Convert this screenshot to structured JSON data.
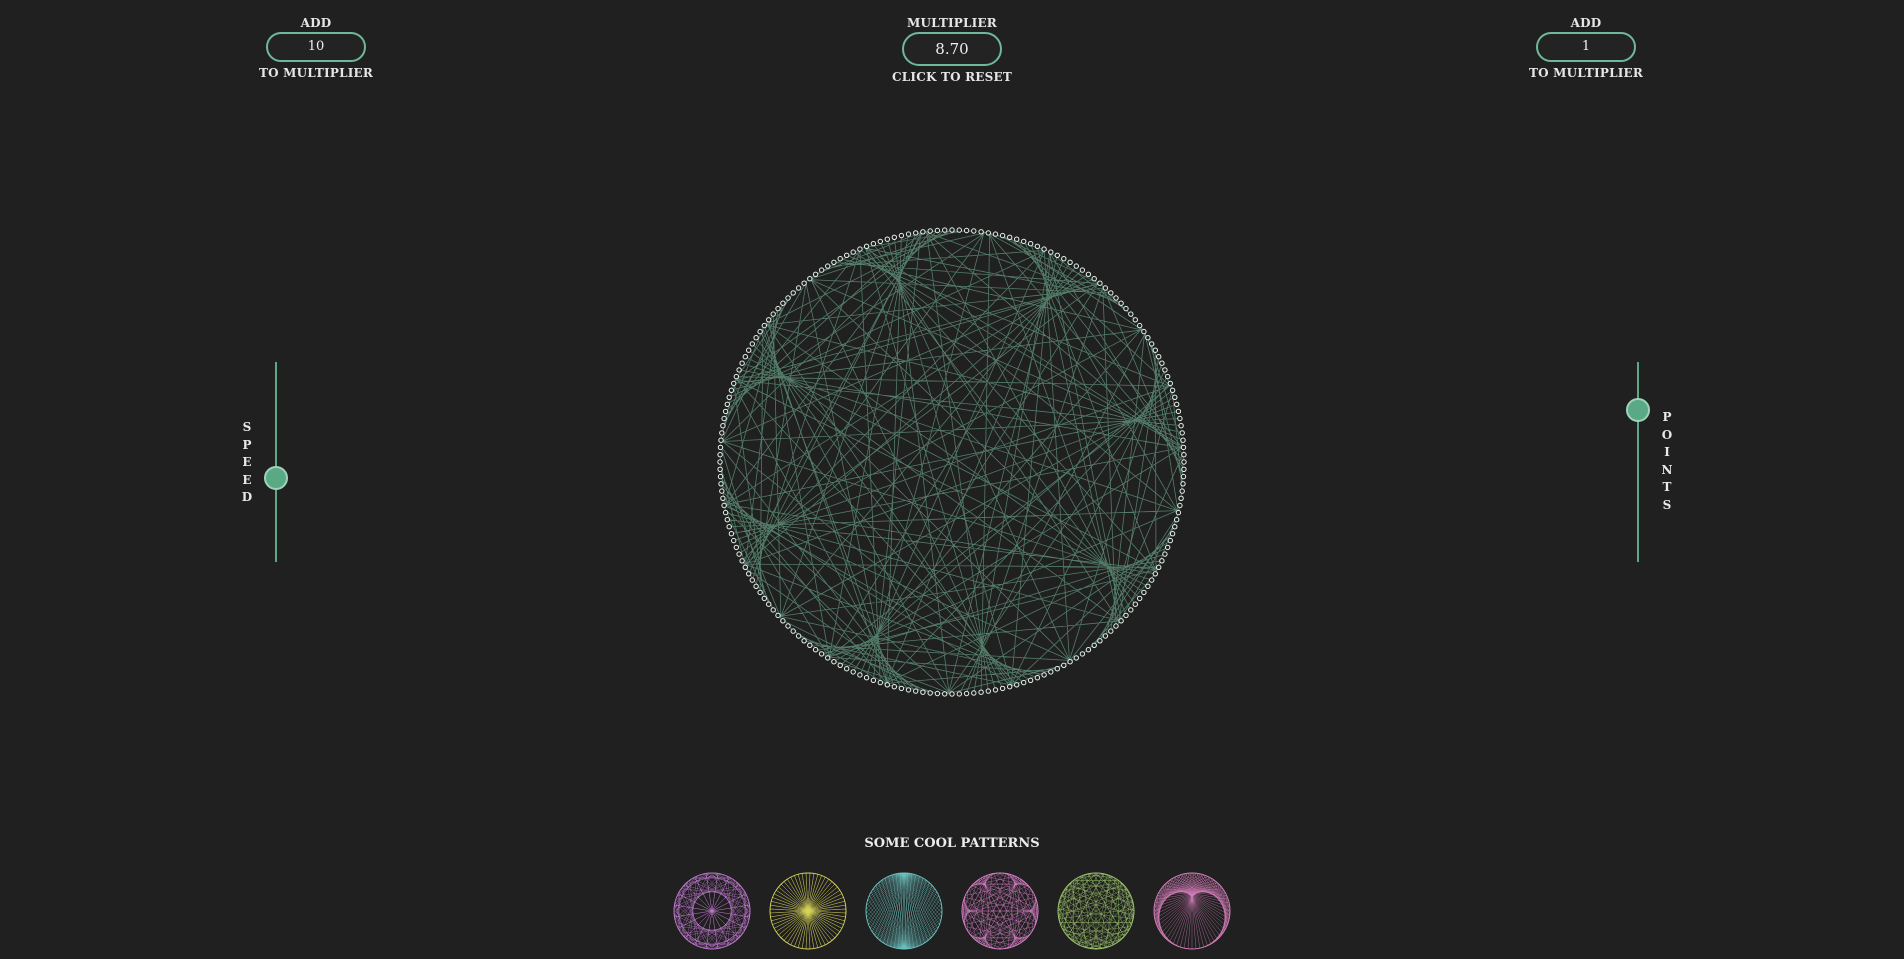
{
  "left_control": {
    "top_label": "ADD",
    "value": "10",
    "bottom_label": "TO MULTIPLIER"
  },
  "multiplier_control": {
    "top_label": "MULTIPLIER",
    "value": "8.70",
    "bottom_label": "CLICK TO RESET"
  },
  "right_control": {
    "top_label": "ADD",
    "value": "1",
    "bottom_label": "TO MULTIPLIER"
  },
  "speed_slider": {
    "label": "SPEED",
    "level": 0.58
  },
  "points_slider": {
    "label": "POINTS",
    "level": 0.24
  },
  "main_visual": {
    "points": 200,
    "multiplier": 8.7,
    "line_color": "#7ec9a6",
    "dot_color": "#e8f4ee"
  },
  "patterns": {
    "title": "SOME COOL PATTERNS",
    "items": [
      {
        "name": "pattern-violet-mandala",
        "color": "#c27ad2",
        "points": 120,
        "multiplier": 21
      },
      {
        "name": "pattern-yellow-star",
        "color": "#d9d45a",
        "points": 120,
        "multiplier": 61
      },
      {
        "name": "pattern-teal-grid",
        "color": "#6cc3c1",
        "points": 120,
        "multiplier": 60
      },
      {
        "name": "pattern-pink-flower",
        "color": "#d77fc8",
        "points": 120,
        "multiplier": 7
      },
      {
        "name": "pattern-green-lattice",
        "color": "#9cc46b",
        "points": 120,
        "multiplier": 34
      },
      {
        "name": "pattern-magenta-cardioid",
        "color": "#d67fba",
        "points": 120,
        "multiplier": 2
      }
    ]
  }
}
